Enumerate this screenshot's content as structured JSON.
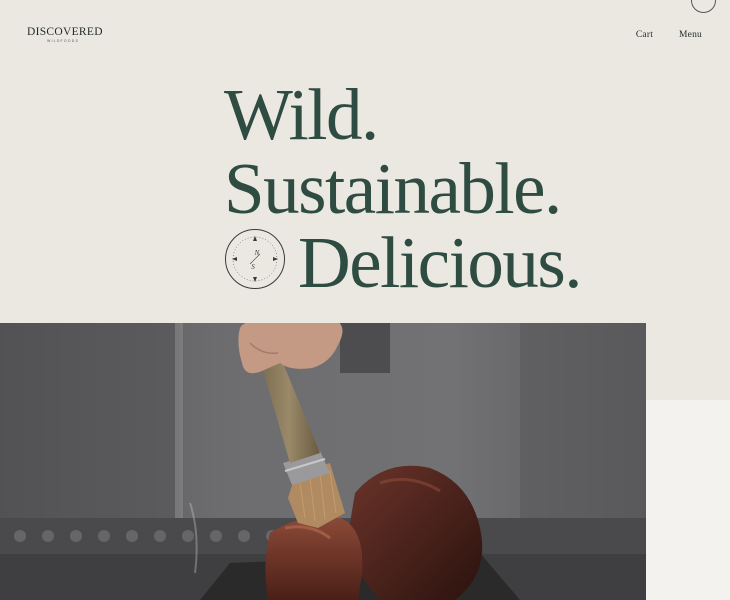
{
  "brand": {
    "name": "DISCOVERED",
    "tagline": "WILDFOODS"
  },
  "nav": {
    "cart_label": "Cart",
    "menu_label": "Menu"
  },
  "hero": {
    "line1": "Wild.",
    "line2": "Sustainable.",
    "line3": "Delicious."
  },
  "compass_badge": {
    "north": "N",
    "south": "S"
  },
  "colors": {
    "background": "#ebe8e2",
    "heading": "#2e4c41",
    "text": "#1f2a26"
  },
  "photo": {
    "subject": "hand brushing marinade onto venison on grill",
    "icon": "photo-image"
  }
}
